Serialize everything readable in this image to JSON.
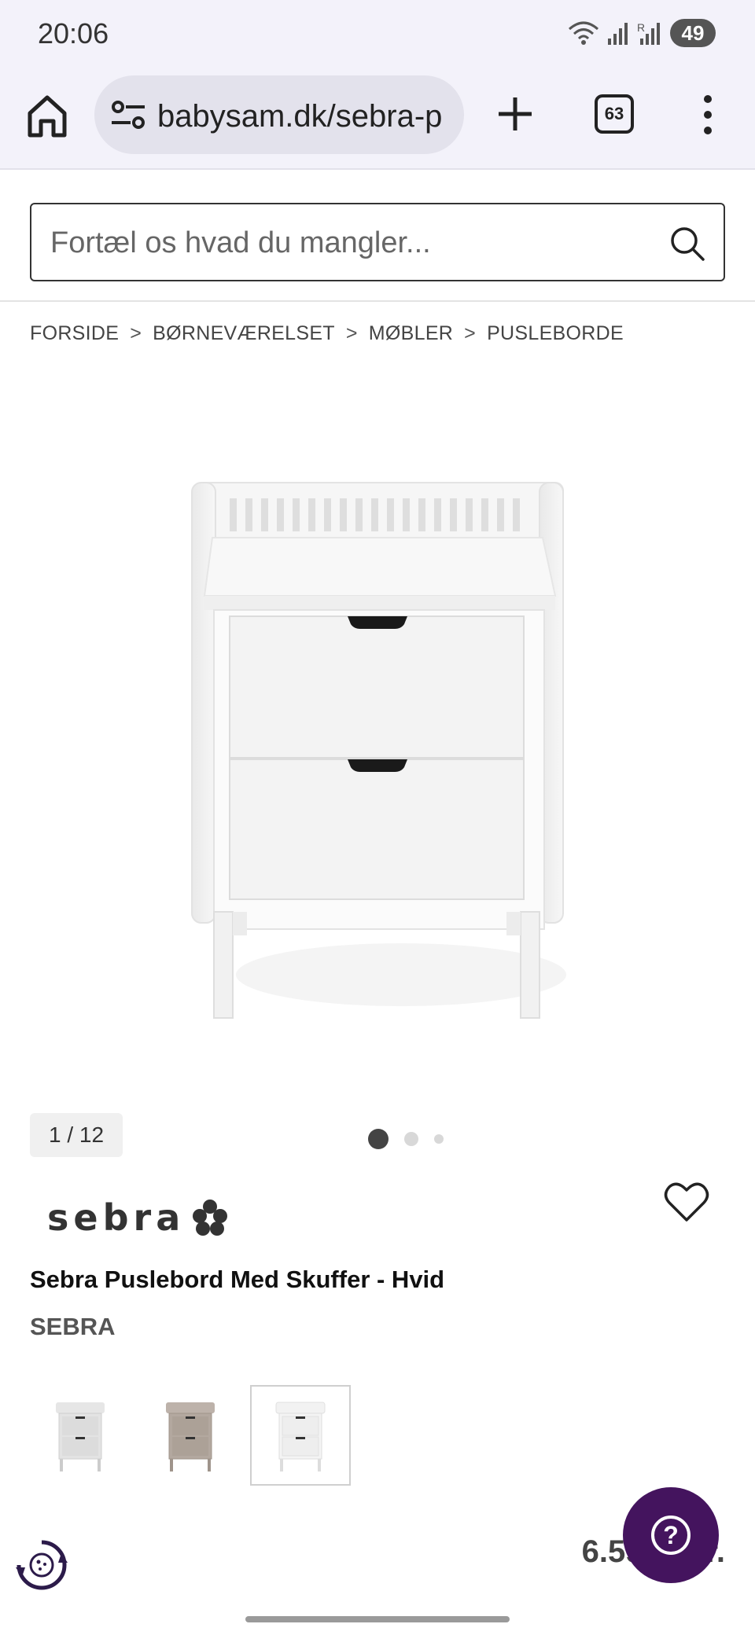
{
  "status_bar": {
    "time": "20:06",
    "battery": "49",
    "icons": [
      "wifi-icon",
      "signal-icon",
      "signal-r-icon",
      "battery-icon"
    ]
  },
  "browser": {
    "url": "babysam.dk/sebra-p",
    "tab_count": "63",
    "icons": [
      "home-icon",
      "site-settings-icon",
      "plus-icon",
      "tabs-icon",
      "more-vert-icon"
    ]
  },
  "search": {
    "placeholder": "Fortæl os hvad du mangler...",
    "value": "",
    "icon": "search-icon"
  },
  "breadcrumb": {
    "items": [
      "FORSIDE",
      "BØRNEVÆRELSET",
      "MØBLER",
      "PUSLEBORDE"
    ],
    "separator": ">"
  },
  "gallery": {
    "counter": "1 / 12",
    "dots": 3,
    "active_dot": 0
  },
  "product": {
    "logo_text": "sebra",
    "title": "Sebra Puslebord Med Skuffer - Hvid",
    "brand": "SEBRA",
    "price": "6.599,- kr.",
    "favorite_icon": "heart-outline-icon"
  },
  "variants": [
    {
      "color": "light-grey",
      "selected": false
    },
    {
      "color": "taupe",
      "selected": false
    },
    {
      "color": "white",
      "selected": true
    }
  ],
  "colors": {
    "chrome_bg": "#f3f2fa",
    "help_button": "#44145e",
    "price_text": "#444444"
  }
}
